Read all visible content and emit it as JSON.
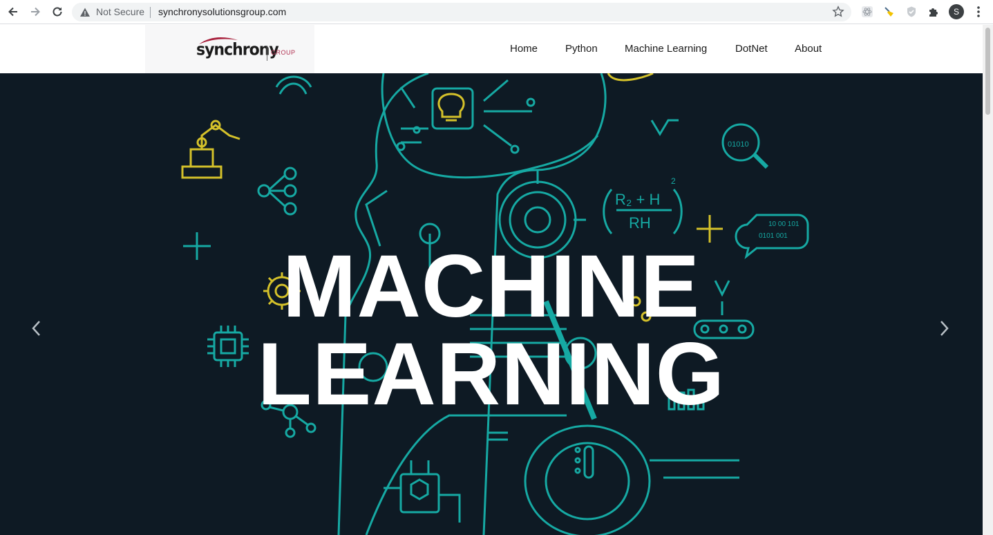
{
  "browser": {
    "security_label": "Not Secure",
    "url": "synchronysolutionsgroup.com",
    "avatar_letter": "S"
  },
  "site": {
    "logo_word": "synchrony",
    "logo_group": "GROUP",
    "nav": [
      {
        "label": "Home"
      },
      {
        "label": "Python"
      },
      {
        "label": "Machine Learning"
      },
      {
        "label": "DotNet"
      },
      {
        "label": "About"
      }
    ]
  },
  "hero": {
    "title_line1": "MACHINE",
    "title_line2": "LEARNING",
    "art_labels": {
      "binary1": "01010",
      "formula_top": "R₂ + H",
      "formula_bottom": "RH",
      "exponent": "2",
      "bubble_line1": "10 00 101",
      "bubble_line2": "0101 001"
    }
  },
  "colors": {
    "hero_bg": "#0e1a24",
    "teal": "#16a9a3",
    "yellow": "#d4c12a"
  }
}
